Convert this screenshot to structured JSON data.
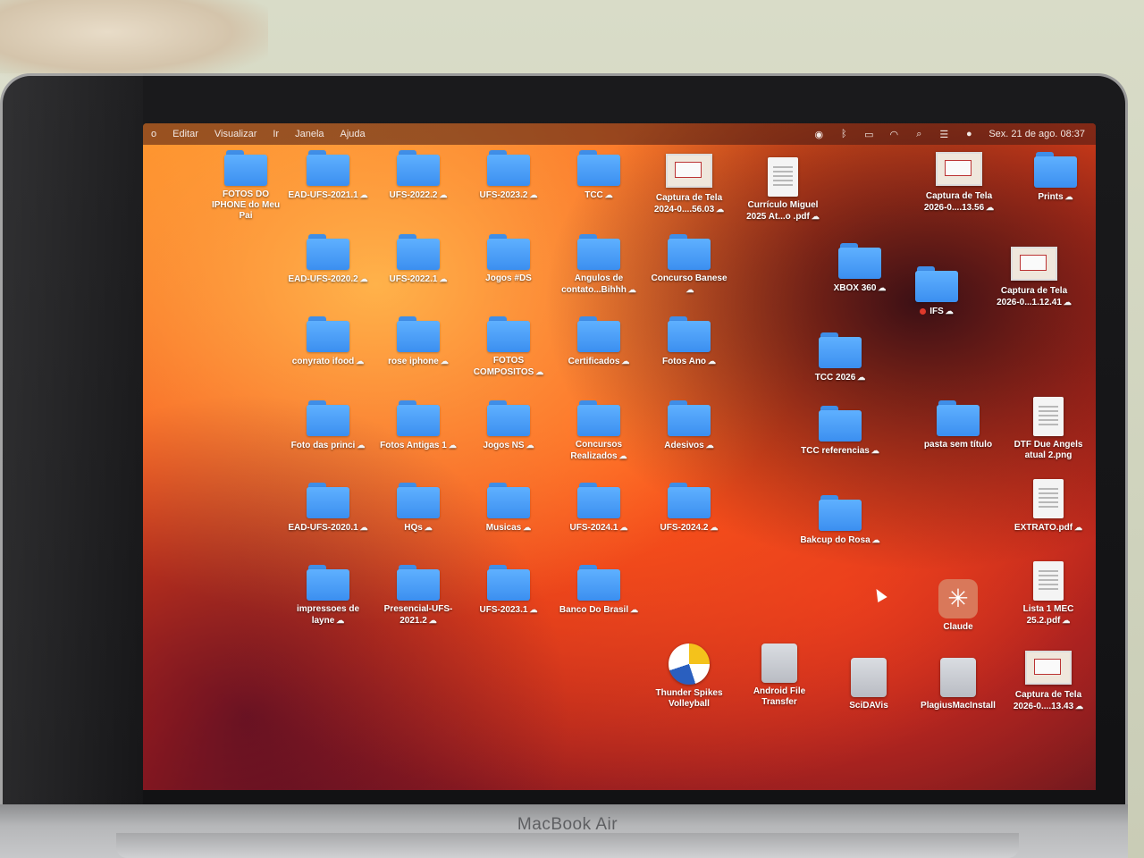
{
  "hardware": {
    "brand": "MacBook Air"
  },
  "menubar": {
    "items": [
      "o",
      "Editar",
      "Visualizar",
      "Ir",
      "Janela",
      "Ajuda"
    ],
    "status_icons": [
      "airdrop-icon",
      "bluetooth-icon",
      "battery-charging-icon",
      "wifi-icon",
      "search-icon",
      "control-center-icon",
      "siri-icon"
    ],
    "clock": "Sex. 21 de ago.  08:37"
  },
  "desktop": {
    "icons": [
      {
        "label": "FOTOS DO IPHONE do Meu Pai",
        "kind": "folder",
        "cloud": false
      },
      {
        "label": "EAD-UFS-2021.1",
        "kind": "folder",
        "cloud": true
      },
      {
        "label": "UFS-2022.2",
        "kind": "folder",
        "cloud": true
      },
      {
        "label": "UFS-2023.2",
        "kind": "folder",
        "cloud": true
      },
      {
        "label": "TCC",
        "kind": "folder",
        "cloud": true
      },
      {
        "label": "Captura de Tela 2024-0....56.03",
        "kind": "screenshot",
        "cloud": true
      },
      {
        "label": "Currículo Miguel 2025 At...o .pdf",
        "kind": "document",
        "cloud": true
      },
      {
        "label": "Captura de Tela 2026-0....13.56",
        "kind": "screenshot",
        "cloud": true
      },
      {
        "label": "Prints",
        "kind": "folder",
        "cloud": true
      },
      {
        "label": "EAD-UFS-2020.2",
        "kind": "folder",
        "cloud": true
      },
      {
        "label": "UFS-2022.1",
        "kind": "folder",
        "cloud": true
      },
      {
        "label": "Jogos #DS",
        "kind": "folder",
        "cloud": false
      },
      {
        "label": "Angulos de contato...Bihhh",
        "kind": "folder",
        "cloud": true
      },
      {
        "label": "Concurso Banese",
        "kind": "folder",
        "cloud": true
      },
      {
        "label": "XBOX 360",
        "kind": "folder",
        "cloud": true
      },
      {
        "label": "IFS",
        "kind": "folder",
        "cloud": true,
        "tag": true
      },
      {
        "label": "Captura de Tela 2026-0...1.12.41",
        "kind": "screenshot",
        "cloud": true
      },
      {
        "label": "conyrato ifood",
        "kind": "folder",
        "cloud": true
      },
      {
        "label": "rose iphone",
        "kind": "folder",
        "cloud": true
      },
      {
        "label": "FOTOS COMPOSITOS",
        "kind": "folder",
        "cloud": true
      },
      {
        "label": "Certificados",
        "kind": "folder",
        "cloud": true
      },
      {
        "label": "Fotos Ano",
        "kind": "folder",
        "cloud": true
      },
      {
        "label": "TCC 2026",
        "kind": "folder",
        "cloud": true
      },
      {
        "label": "Foto das princi",
        "kind": "folder",
        "cloud": true
      },
      {
        "label": "Fotos Antigas 1",
        "kind": "folder",
        "cloud": true
      },
      {
        "label": "Jogos NS",
        "kind": "folder",
        "cloud": true
      },
      {
        "label": "Concursos Realizados",
        "kind": "folder",
        "cloud": true
      },
      {
        "label": "Adesivos",
        "kind": "folder",
        "cloud": true
      },
      {
        "label": "TCC referencias",
        "kind": "folder",
        "cloud": true
      },
      {
        "label": "pasta sem título",
        "kind": "folder",
        "cloud": false
      },
      {
        "label": "DTF Due Angels atual 2.png",
        "kind": "document",
        "cloud": false
      },
      {
        "label": "EAD-UFS-2020.1",
        "kind": "folder",
        "cloud": true
      },
      {
        "label": "HQs",
        "kind": "folder",
        "cloud": true
      },
      {
        "label": "Musicas",
        "kind": "folder",
        "cloud": true
      },
      {
        "label": "UFS-2024.1",
        "kind": "folder",
        "cloud": true
      },
      {
        "label": "UFS-2024.2",
        "kind": "folder",
        "cloud": true
      },
      {
        "label": "Bakcup do Rosa",
        "kind": "folder",
        "cloud": true
      },
      {
        "label": "EXTRATO.pdf",
        "kind": "document",
        "cloud": true
      },
      {
        "label": "impressoes de layne",
        "kind": "folder",
        "cloud": true
      },
      {
        "label": "Presencial-UFS-2021.2",
        "kind": "folder",
        "cloud": true
      },
      {
        "label": "UFS-2023.1",
        "kind": "folder",
        "cloud": true
      },
      {
        "label": "Banco Do Brasil",
        "kind": "folder",
        "cloud": true
      },
      {
        "label": "Claude",
        "kind": "app",
        "cloud": false
      },
      {
        "label": "Lista 1 MEC 25.2.pdf",
        "kind": "document",
        "cloud": true
      },
      {
        "label": "Thunder Spikes Volleyball",
        "kind": "game",
        "cloud": false
      },
      {
        "label": "Android File Transfer",
        "kind": "disk",
        "cloud": false
      },
      {
        "label": "SciDAVis",
        "kind": "disk",
        "cloud": false
      },
      {
        "label": "PlagiusMacInstall",
        "kind": "disk",
        "cloud": false
      },
      {
        "label": "Captura de Tela 2026-0....13.43",
        "kind": "screenshot",
        "cloud": true
      }
    ]
  },
  "colors": {
    "folder": "#3b8ff0",
    "wallpaper_primary": "#f2461a",
    "wallpaper_dark": "#2b0a1e"
  }
}
